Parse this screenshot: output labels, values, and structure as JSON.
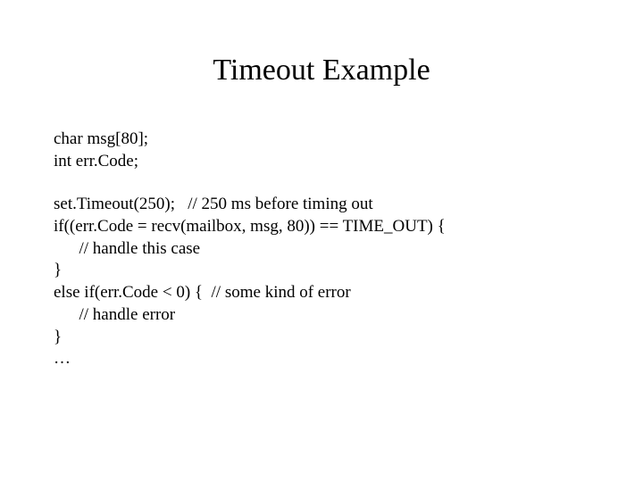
{
  "title": "Timeout Example",
  "lines": {
    "l0": "char msg[80];",
    "l1": "int err.Code;",
    "l2": "set.Timeout(250);   // 250 ms before timing out",
    "l3": "if((err.Code = recv(mailbox, msg, 80)) == TIME_OUT) {",
    "l4": "      // handle this case",
    "l5": "}",
    "l6": "else if(err.Code < 0) {  // some kind of error",
    "l7": "      // handle error",
    "l8": "}",
    "l9": "…"
  }
}
